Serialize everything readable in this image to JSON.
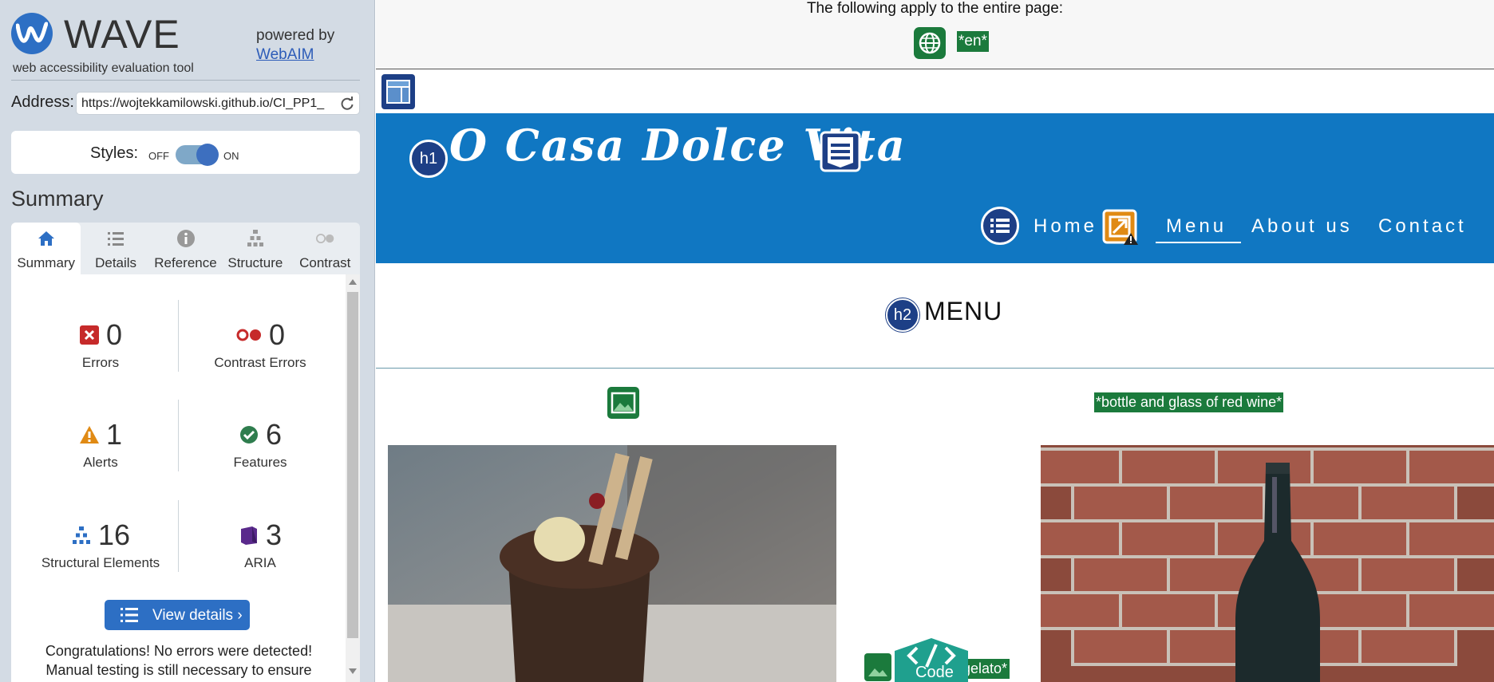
{
  "wave": {
    "logo_text": "WAVE",
    "tagline": "web accessibility evaluation tool",
    "powered_by": "powered by",
    "webaim_link": "WebAIM",
    "address_label": "Address:",
    "address_value": "https://wojtekkamilowski.github.io/CI_PP1_",
    "styles_label": "Styles:",
    "styles_off": "OFF",
    "styles_on": "ON",
    "summary_title": "Summary",
    "tabs": [
      {
        "label": "Summary",
        "icon": "home-icon",
        "active": true
      },
      {
        "label": "Details",
        "icon": "list-icon"
      },
      {
        "label": "Reference",
        "icon": "info-icon"
      },
      {
        "label": "Structure",
        "icon": "hierarchy-icon"
      },
      {
        "label": "Contrast",
        "icon": "contrast-icon"
      }
    ],
    "stats": {
      "errors": {
        "count": "0",
        "label": "Errors"
      },
      "contrast_errors": {
        "count": "0",
        "label": "Contrast Errors"
      },
      "alerts": {
        "count": "1",
        "label": "Alerts"
      },
      "features": {
        "count": "6",
        "label": "Features"
      },
      "structural": {
        "count": "16",
        "label": "Structural Elements"
      },
      "aria": {
        "count": "3",
        "label": "ARIA"
      }
    },
    "view_details": "View details ›",
    "congrats_line1": "Congratulations! No errors were detected!",
    "congrats_line2": "Manual testing is still necessary to ensure"
  },
  "page": {
    "doc_notice": "The following apply to the entire page:",
    "lang_tag": "*en*",
    "brand": "O Casa Dolce Vita",
    "nav": [
      "Home",
      "Menu",
      "About us",
      "Contact"
    ],
    "h1_badge": "h1",
    "h2_badge": "h2",
    "menu_heading": "MENU",
    "alt_wine": "*bottle and glass of red wine*",
    "alt_gelato": "gelato*",
    "code_label": "Code"
  },
  "colors": {
    "wave_blue": "#2d6fc4",
    "header_blue": "#1077c2",
    "feature_green": "#1b7a3c",
    "error_red": "#c62a2a",
    "alert_orange": "#e08a14",
    "aria_purple": "#5a2a8c"
  }
}
